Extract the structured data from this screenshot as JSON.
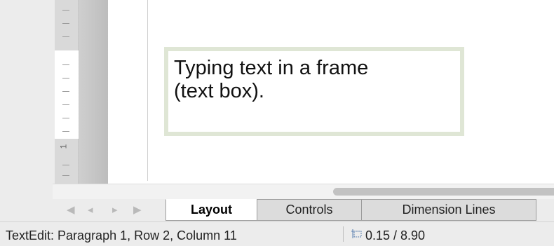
{
  "frame": {
    "line1": "Typing text in a frame",
    "line2": "(text box)."
  },
  "ruler": {
    "label": "1"
  },
  "navigation": {
    "first_icon": "first-sheet-icon",
    "prev_icon": "previous-sheet-icon",
    "next_icon": "next-sheet-icon",
    "last_icon": "last-sheet-icon"
  },
  "tabs": [
    {
      "label": "Layout",
      "active": true
    },
    {
      "label": "Controls",
      "active": false
    },
    {
      "label": "Dimension Lines",
      "active": false
    }
  ],
  "status": {
    "edit_info": "TextEdit: Paragraph 1, Row 2, Column 11",
    "size_icon": "object-size-icon",
    "size": "0.15 / 8.90"
  }
}
